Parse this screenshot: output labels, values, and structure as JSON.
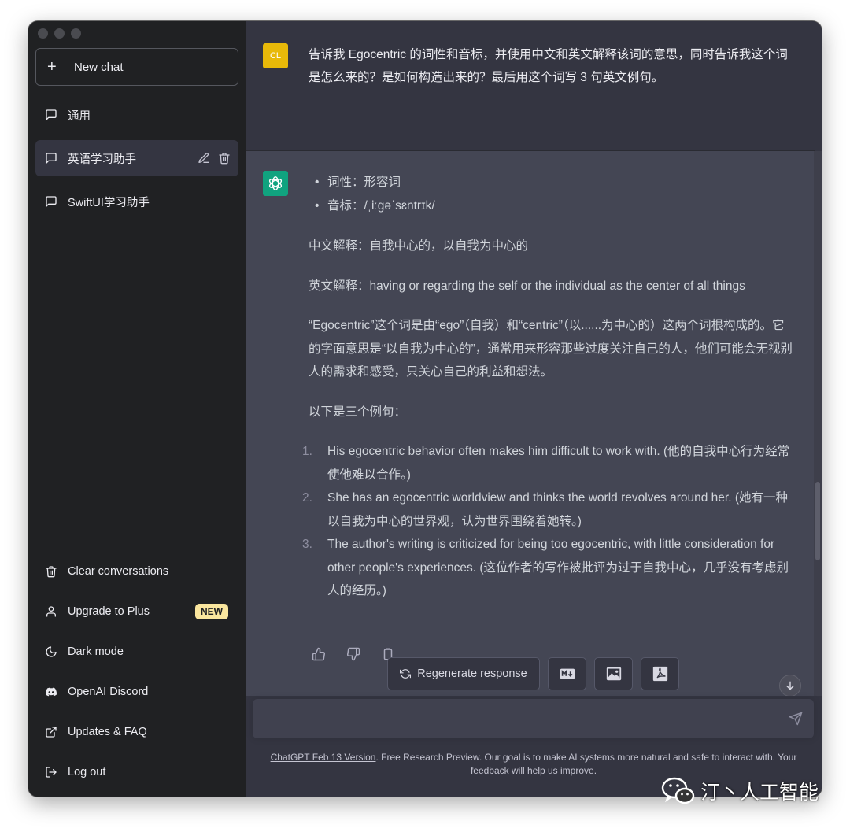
{
  "sidebar": {
    "new_chat": "New chat",
    "conversations": [
      {
        "label": "通用"
      },
      {
        "label": "英语学习助手"
      },
      {
        "label": "SwiftUI学习助手"
      }
    ],
    "menu": {
      "clear": "Clear conversations",
      "upgrade": "Upgrade to Plus",
      "upgrade_badge": "NEW",
      "dark_mode": "Dark mode",
      "discord": "OpenAI Discord",
      "faq": "Updates & FAQ",
      "logout": "Log out"
    }
  },
  "user_message": {
    "avatar": "CL",
    "text": "告诉我 Egocentric 的词性和音标，并使用中文和英文解释该词的意思，同时告诉我这个词是怎么来的？是如何构造出来的？最后用这个词写 3 句英文例句。"
  },
  "assistant_message": {
    "bullets": [
      "词性：形容词",
      "音标：/ˌiːɡəˈsɛntrɪk/"
    ],
    "chinese_explanation": "中文解释：自我中心的，以自我为中心的",
    "english_explanation": "英文解释：having or regarding the self or the individual as the center of all things",
    "origin": "“Egocentric”这个词是由“ego”（自我）和“centric”（以......为中心的）这两个词根构成的。它的字面意思是“以自我为中心的”，通常用来形容那些过度关注自己的人，他们可能会无视别人的需求和感受，只关心自己的利益和想法。",
    "examples_intro": "以下是三个例句：",
    "examples": [
      {
        "num": "1.",
        "text": "His egocentric behavior often makes him difficult to work with. (他的自我中心行为经常使他难以合作。)"
      },
      {
        "num": "2.",
        "text": "She has an egocentric worldview and thinks the world revolves around her. (她有一种以自我为中心的世界观，认为世界围绕着她转。)"
      },
      {
        "num": "3.",
        "text": "The author's writing is criticized for being too egocentric, with little consideration for other people's experiences. (这位作者的写作被批评为过于自我中心，几乎没有考虑别人的经历。)"
      }
    ]
  },
  "actions": {
    "regenerate": "Regenerate response"
  },
  "input": {
    "placeholder": ""
  },
  "footer": {
    "link": "ChatGPT Feb 13 Version",
    "text": ". Free Research Preview. Our goal is to make AI systems more natural and safe to interact with. Your feedback will help us improve."
  },
  "watermark": {
    "text": "汀丶人工智能"
  },
  "colors": {
    "sidebar_bg": "#202123",
    "main_bg": "#343541",
    "assistant_bg": "#444654",
    "user_avatar": "#e8b909",
    "assistant_avatar": "#10a37f",
    "badge": "#fae69e"
  }
}
